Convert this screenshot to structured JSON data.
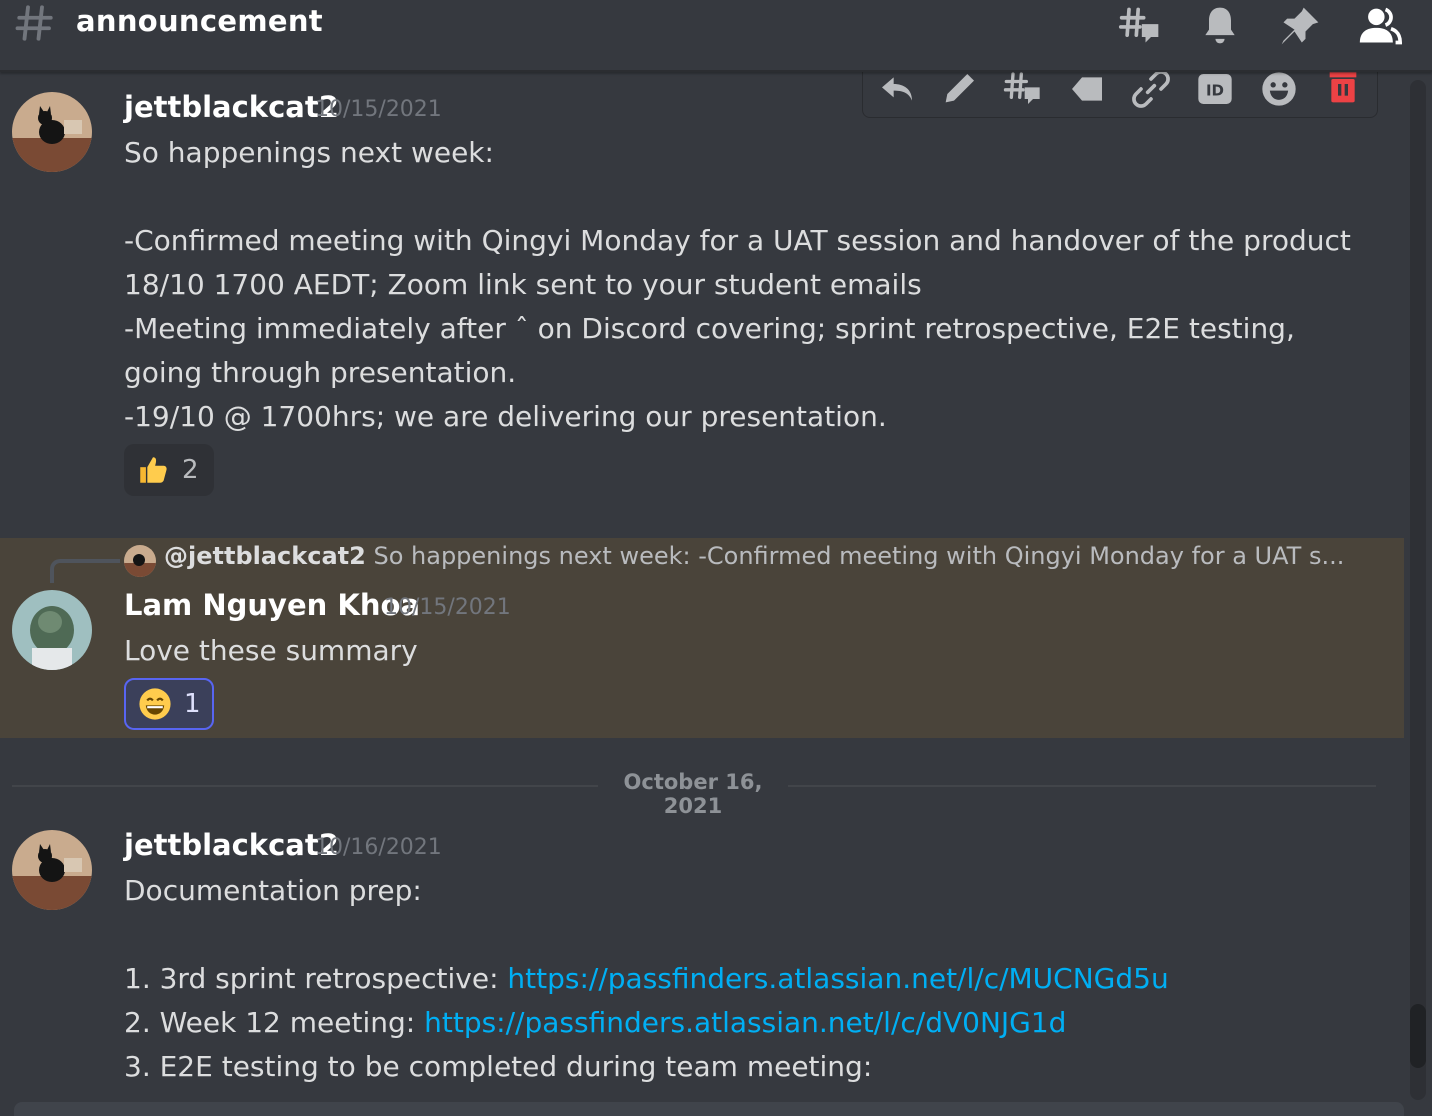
{
  "header": {
    "channel_name": "announcement",
    "icons": [
      "threads-icon",
      "notification-bell-icon",
      "pin-icon",
      "member-list-icon"
    ]
  },
  "toolbar": {
    "icons": [
      "reply-icon",
      "edit-icon",
      "create-thread-icon",
      "mark-unread-icon",
      "copy-link-icon",
      "copy-id-icon",
      "add-reaction-icon",
      "delete-icon"
    ]
  },
  "messages": [
    {
      "author": "jettblackcat2",
      "timestamp": "10/15/2021",
      "lines": [
        "So happenings next week:",
        "",
        "-Confirmed meeting with Qingyi Monday for a UAT session and handover of the product",
        "18/10 1700 AEDT; Zoom link sent to your student emails",
        "-Meeting immediately after ˆ on Discord covering; sprint retrospective, E2E testing,",
        "going through presentation.",
        "-19/10 @ 1700hrs; we are delivering our presentation."
      ],
      "reaction": {
        "emoji": "thumbs-up",
        "count": "2"
      }
    },
    {
      "reply": {
        "mention": "@jettblackcat2",
        "preview": "So happenings next week:  -Confirmed meeting with Qingyi Monday for a UAT s..."
      },
      "author": "Lam Nguyen Khoa",
      "timestamp": "10/15/2021",
      "lines": [
        "Love these summary"
      ],
      "reaction": {
        "emoji": "grinning-face",
        "count": "1"
      }
    },
    {
      "author": "jettblackcat2",
      "timestamp": "10/16/2021",
      "lines": [
        "Documentation prep:",
        "",
        "1. 3rd sprint retrospective: ",
        "2. Week 12 meeting: ",
        "3. E2E testing to be completed during team meeting:"
      ],
      "links": [
        "https://passfinders.atlassian.net/l/c/MUCNGd5u",
        "https://passfinders.atlassian.net/l/c/dV0NJG1d"
      ]
    }
  ],
  "date_divider": "October 16, 2021",
  "colors": {
    "background": "#36393f",
    "highlight": "#4a443a",
    "link": "#00aff4",
    "blurple": "#5865f2",
    "delete_red": "#ed4245"
  }
}
